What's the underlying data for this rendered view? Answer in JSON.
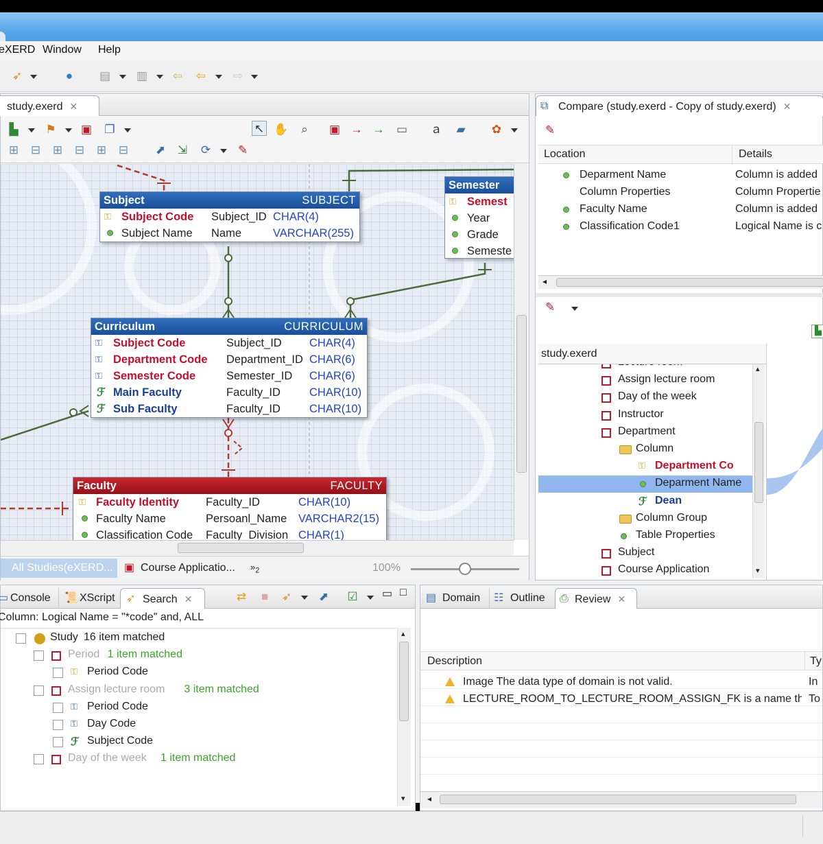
{
  "menu": {
    "exerd": "eXERD",
    "window": "Window",
    "help": "Help"
  },
  "editor": {
    "tab_label": "study.exerd",
    "bottom_tabs": [
      "All Studies(eXERD...",
      "Course Applicatio..."
    ],
    "overflow_label": "2",
    "zoom": "100%",
    "zoom_level_percent": 100
  },
  "entities": {
    "subject": {
      "name": "Subject",
      "physical": "SUBJECT",
      "rows": [
        {
          "logical": "Subject Code",
          "physical": "Subject_ID",
          "type": "CHAR(4)",
          "key": "pk"
        },
        {
          "logical": "Subject Name",
          "physical": "Name",
          "type": "VARCHAR(255)",
          "key": "attr"
        }
      ]
    },
    "semester": {
      "name": "Semester",
      "rows": [
        {
          "logical": "Semest",
          "key": "pk"
        },
        {
          "logical": "Year",
          "key": "attr"
        },
        {
          "logical": "Grade",
          "key": "attr"
        },
        {
          "logical": "Semeste",
          "key": "attr"
        }
      ]
    },
    "curriculum": {
      "name": "Curriculum",
      "physical": "CURRICULUM",
      "rows": [
        {
          "logical": "Subject Code",
          "physical": "Subject_ID",
          "type": "CHAR(4)",
          "key": "pkfk"
        },
        {
          "logical": "Department Code",
          "physical": "Department_ID",
          "type": "CHAR(6)",
          "key": "pkfk"
        },
        {
          "logical": "Semester Code",
          "physical": "Semester_ID",
          "type": "CHAR(6)",
          "key": "pkfk"
        },
        {
          "logical": "Main Faculty",
          "physical": "Faculty_ID",
          "type": "CHAR(10)",
          "key": "fk"
        },
        {
          "logical": "Sub Faculty",
          "physical": "Faculty_ID",
          "type": "CHAR(10)",
          "key": "fk"
        }
      ]
    },
    "faculty": {
      "name": "Faculty",
      "physical": "FACULTY",
      "rows": [
        {
          "logical": "Faculty Identity",
          "physical": "Faculty_ID",
          "type": "CHAR(10)",
          "key": "pk"
        },
        {
          "logical": "Faculty Name",
          "physical": "Persoanl_Name",
          "type": "VARCHAR2(15)",
          "key": "attr"
        },
        {
          "logical": "Classification Code",
          "physical": "Faculty_Division",
          "type": "CHAR(1)",
          "key": "attr"
        }
      ]
    }
  },
  "compare": {
    "title": "Compare (study.exerd - Copy of study.exerd)",
    "columns": [
      "Location",
      "Details"
    ],
    "rows": [
      {
        "location": "Deparment Name",
        "details": "Column is added"
      },
      {
        "location": "Column Properties",
        "details": "Column Propertie"
      },
      {
        "location": "Faculty Name",
        "details": "Column is added"
      },
      {
        "location": "Classification Code1",
        "details": "Logical Name is c"
      }
    ],
    "tree_header": "study.exerd",
    "tree": [
      {
        "label": "Lecture room",
        "icon": "table",
        "indent": 0
      },
      {
        "label": "Assign lecture room",
        "icon": "table",
        "indent": 0
      },
      {
        "label": "Day of the week",
        "icon": "table",
        "indent": 0
      },
      {
        "label": "Instructor",
        "icon": "table",
        "indent": 0
      },
      {
        "label": "Department",
        "icon": "table",
        "indent": 0
      },
      {
        "label": "Column",
        "icon": "folder",
        "indent": 1
      },
      {
        "label": "Department Co",
        "icon": "pk",
        "indent": 2
      },
      {
        "label": "Deparment Name",
        "icon": "attr",
        "indent": 2
      },
      {
        "label": "Dean",
        "icon": "fk",
        "indent": 2
      },
      {
        "label": "Column Group",
        "icon": "folder",
        "indent": 1
      },
      {
        "label": "Table Properties",
        "icon": "attr",
        "indent": 1
      },
      {
        "label": "Subject",
        "icon": "table",
        "indent": 0
      },
      {
        "label": "Course Application",
        "icon": "table",
        "indent": 0
      }
    ]
  },
  "search": {
    "tabs": [
      "Console",
      "XScript",
      "Search"
    ],
    "query": "Column: Logical Name = \"*code\" and, ALL",
    "results": [
      {
        "level": 0,
        "name": "Study",
        "count": "16 item matched",
        "icon": "study"
      },
      {
        "level": 1,
        "name": "Period",
        "count": "1 item matched",
        "icon": "table"
      },
      {
        "level": 2,
        "name": "Period Code",
        "icon": "pk"
      },
      {
        "level": 1,
        "name": "Assign lecture room",
        "count": "3 item matched",
        "icon": "table"
      },
      {
        "level": 2,
        "name": "Period Code",
        "icon": "pkfk"
      },
      {
        "level": 2,
        "name": "Day Code",
        "icon": "pkfk"
      },
      {
        "level": 2,
        "name": "Subject Code",
        "icon": "fk"
      },
      {
        "level": 1,
        "name": "Day of the week",
        "count": "1 item matched",
        "icon": "table"
      }
    ]
  },
  "review": {
    "tabs": [
      "Domain",
      "Outline",
      "Review"
    ],
    "columns": [
      "Description",
      "Ty"
    ],
    "rows": [
      {
        "description": "Image The data type of domain is not valid.",
        "type": "In"
      },
      {
        "description": "LECTURE_ROOM_TO_LECTURE_ROOM_ASSIGN_FK is a name that i",
        "type": "To"
      }
    ]
  },
  "colors": {
    "pk": "#c4102a",
    "fk": "#1a3f9a",
    "entity_blue": "#1a4f99",
    "entity_red": "#941117",
    "title_bar": "#5aa8ea"
  }
}
